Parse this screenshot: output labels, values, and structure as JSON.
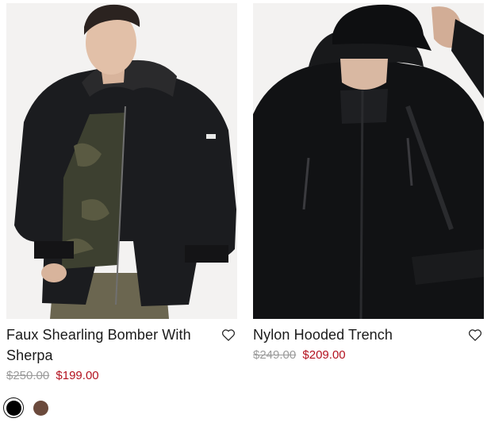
{
  "products": [
    {
      "name": "Faux Shearling Bomber With Sherpa",
      "original_price": "$250.00",
      "sale_price": "$199.00",
      "wishlist_icon": "heart-outline-icon",
      "image_alt": "Model wearing black faux shearling bomber jacket",
      "swatches": [
        {
          "color": "#000000",
          "selected": true
        },
        {
          "color": "#6b4a3c",
          "selected": false
        }
      ]
    },
    {
      "name": "Nylon Hooded Trench",
      "original_price": "$249.00",
      "sale_price": "$209.00",
      "wishlist_icon": "heart-outline-icon",
      "image_alt": "Model wearing black nylon hooded trench and cap"
    }
  ],
  "colors": {
    "sale": "#b3121f",
    "strike": "#9b9b9b",
    "text": "#1a1a1a"
  }
}
